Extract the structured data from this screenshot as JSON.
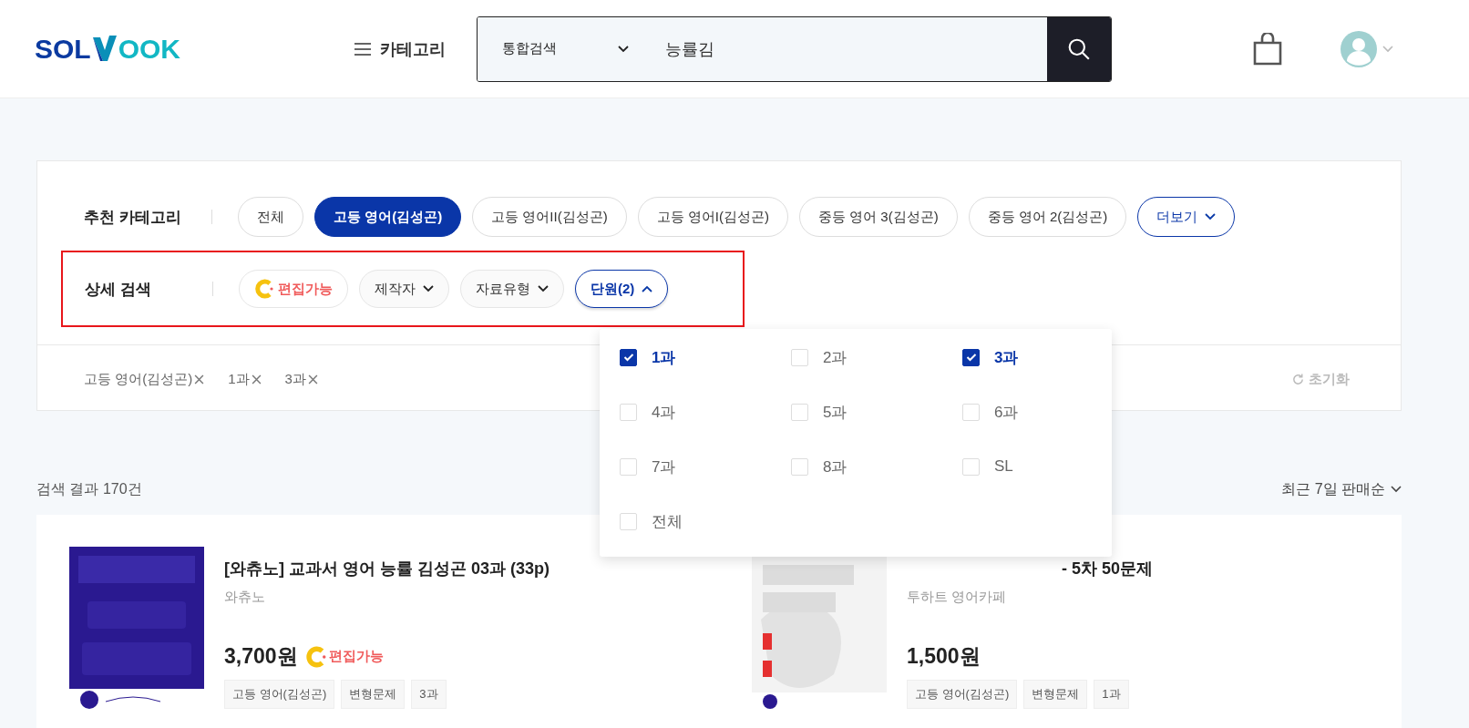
{
  "header": {
    "logo": {
      "left": "SOL",
      "right": "OOK"
    },
    "category_menu": "카테고리",
    "search": {
      "scope": "통합검색",
      "value": "능률김"
    }
  },
  "recommended": {
    "label": "추천 카테고리",
    "chips": [
      {
        "label": "전체",
        "selected": false
      },
      {
        "label": "고등 영어(김성곤)",
        "selected": true
      },
      {
        "label": "고등 영어II(김성곤)",
        "selected": false
      },
      {
        "label": "고등 영어I(김성곤)",
        "selected": false
      },
      {
        "label": "중등 영어 3(김성곤)",
        "selected": false
      },
      {
        "label": "중등 영어 2(김성곤)",
        "selected": false
      }
    ],
    "more": "더보기"
  },
  "detail_search": {
    "label": "상세 검색",
    "highlighted": true,
    "filters": [
      {
        "kind": "editable",
        "label": "편집가능"
      },
      {
        "kind": "dropdown",
        "label": "제작자",
        "expanded": false
      },
      {
        "kind": "dropdown",
        "label": "자료유형",
        "expanded": false
      },
      {
        "kind": "dropdown",
        "label": "단원(2)",
        "expanded": true
      }
    ]
  },
  "applied_filters": {
    "tags": [
      "고등 영어(김성곤)",
      "1과",
      "3과"
    ],
    "reset": "초기화"
  },
  "unit_options": [
    {
      "label": "1과",
      "checked": true
    },
    {
      "label": "2과",
      "checked": false
    },
    {
      "label": "3과",
      "checked": true
    },
    {
      "label": "4과",
      "checked": false
    },
    {
      "label": "5과",
      "checked": false
    },
    {
      "label": "6과",
      "checked": false
    },
    {
      "label": "7과",
      "checked": false
    },
    {
      "label": "8과",
      "checked": false
    },
    {
      "label": "SL",
      "checked": false
    },
    {
      "label": "전체",
      "checked": false
    }
  ],
  "results": {
    "count": "검색 결과 170건",
    "sort": "최근 7일 판매순",
    "products": [
      {
        "title": "[와츄노] 교과서 영어 능률 김성곤 03과 (33p)",
        "seller": "와츄노",
        "price": "3,700원",
        "editable": true,
        "editable_label": "편집가능",
        "tags": [
          "고등 영어(김성곤)",
          "변형문제",
          "3과"
        ]
      },
      {
        "title": "- 5차 50문제",
        "seller": "투하트 영어카페",
        "price": "1,500원",
        "editable": false,
        "tags": [
          "고등 영어(김성곤)",
          "변형문제",
          "1과"
        ]
      }
    ]
  }
}
